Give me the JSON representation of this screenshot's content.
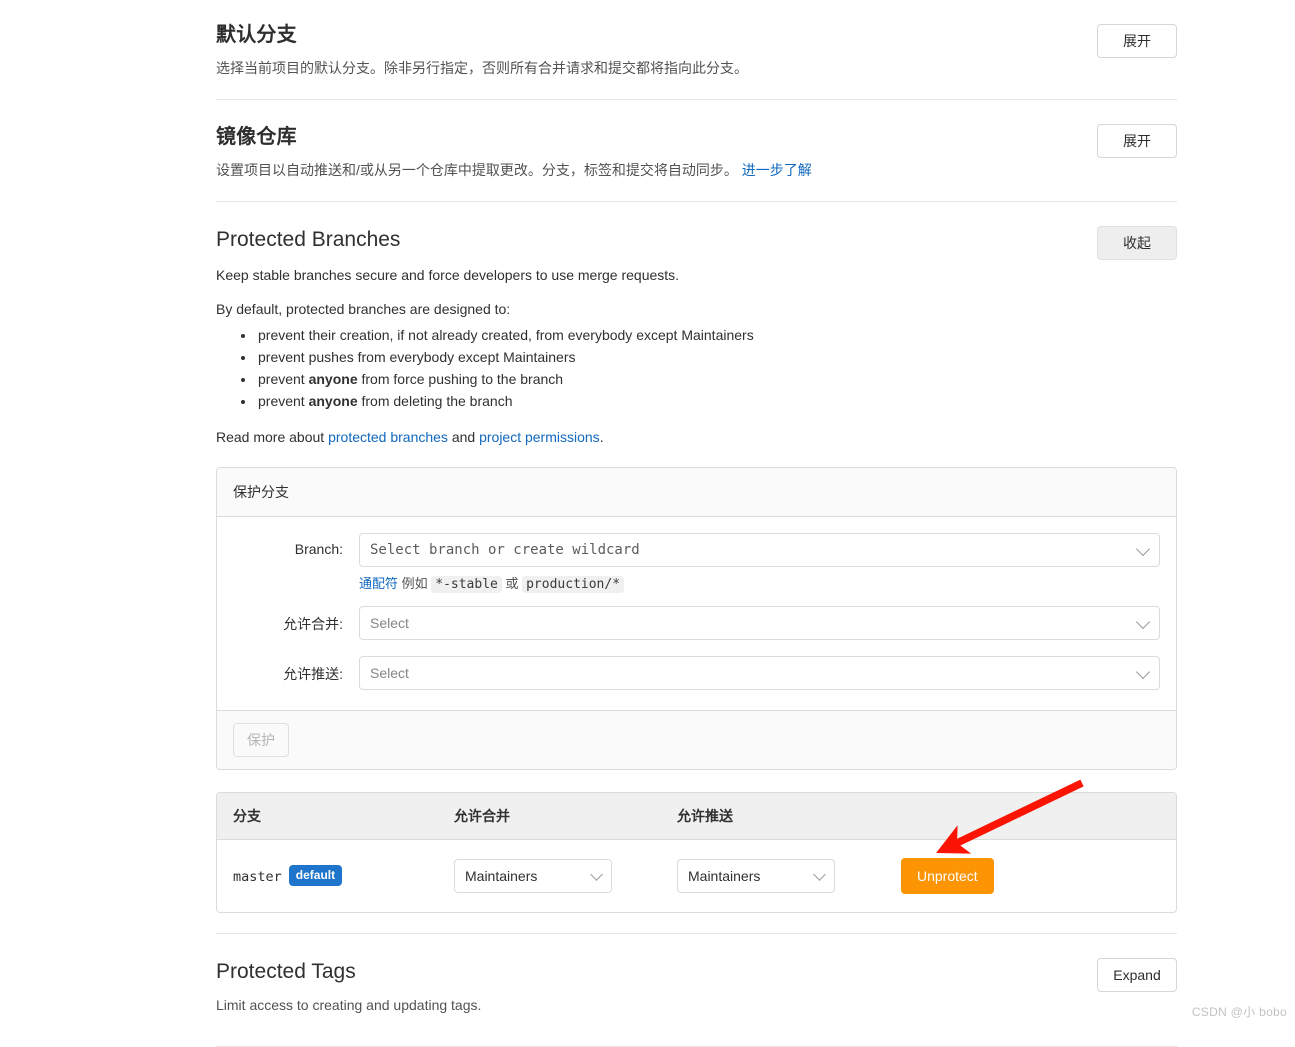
{
  "sections": [
    {
      "id": "default-branch",
      "title": "默认分支",
      "description": "选择当前项目的默认分支。除非另行指定，否则所有合并请求和提交都将指向此分支。",
      "toggle_label": "展开",
      "toggle_state": "collapsed"
    },
    {
      "id": "mirror-repository",
      "title": "镜像仓库",
      "description": "设置项目以自动推送和/或从另一个仓库中提取更改。分支，标签和提交将自动同步。",
      "description_link": "进一步了解",
      "toggle_label": "展开",
      "toggle_state": "collapsed"
    },
    {
      "id": "protected-branches",
      "title": "Protected Branches",
      "description": "Keep stable branches secure and force developers to use merge requests.",
      "toggle_label": "收起",
      "toggle_state": "expanded"
    },
    {
      "id": "protected-tags",
      "title": "Protected Tags",
      "description": "Limit access to creating and updating tags.",
      "toggle_label": "Expand",
      "toggle_state": "collapsed"
    }
  ],
  "protected_branches": {
    "intro": "By default, protected branches are designed to:",
    "bullets": [
      {
        "prefix": "prevent their creation, if not already created, from everybody except Maintainers",
        "bold": "",
        "suffix": ""
      },
      {
        "prefix": "prevent pushes from everybody except Maintainers",
        "bold": "",
        "suffix": ""
      },
      {
        "prefix": "prevent ",
        "bold": "anyone",
        "suffix": " from force pushing to the branch"
      },
      {
        "prefix": "prevent ",
        "bold": "anyone",
        "suffix": " from deleting the branch"
      }
    ],
    "read_more_prefix": "Read more about ",
    "read_more_link1": "protected branches",
    "read_more_mid": " and ",
    "read_more_link2": "project permissions",
    "read_more_suffix": ".",
    "form": {
      "panel_title": "保护分支",
      "branch_label": "Branch:",
      "branch_placeholder": "Select branch or create wildcard",
      "hint_link": "通配符",
      "hint_text_1": " 例如 ",
      "hint_code_1": "*-stable",
      "hint_text_2": " 或 ",
      "hint_code_2": "production/*",
      "allowed_merge_label": "允许合并:",
      "allowed_merge_placeholder": "Select",
      "allowed_push_label": "允许推送:",
      "allowed_push_placeholder": "Select",
      "submit_label": "保护"
    },
    "table": {
      "columns": [
        "分支",
        "允许合并",
        "允许推送"
      ],
      "rows": [
        {
          "branch": "master",
          "badge": "default",
          "allowed_merge": "Maintainers",
          "allowed_push": "Maintainers",
          "action_label": "Unprotect"
        }
      ]
    }
  },
  "annotation": {
    "type": "red-arrow",
    "color": "#fb1404",
    "points_to": "Unprotect"
  },
  "watermark": "CSDN @小 bobo",
  "colors": {
    "link": "#1068bf",
    "badge_blue": "#1f75cb",
    "unprotect_orange": "#fc9403",
    "arrow_red": "#fb1404",
    "panel_border": "#dbdbdb",
    "table_head_bg": "#f0f0f0"
  }
}
